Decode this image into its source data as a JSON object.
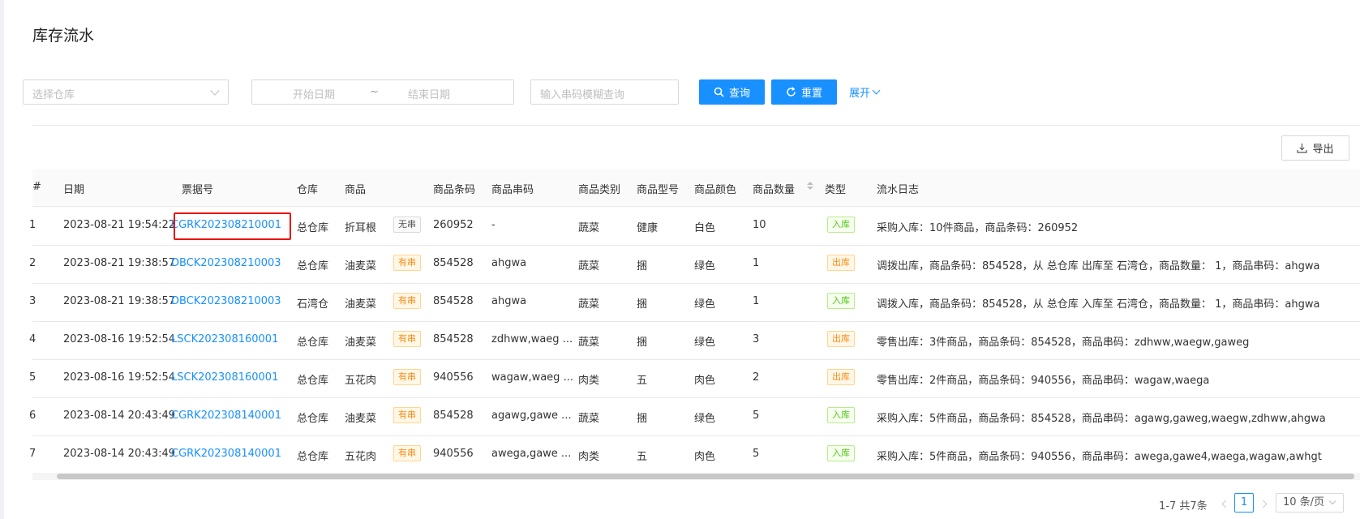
{
  "page": {
    "title": "库存流水"
  },
  "filters": {
    "warehouse_placeholder": "选择仓库",
    "start_date_placeholder": "开始日期",
    "date_separator": "~",
    "end_date_placeholder": "结束日期",
    "serial_placeholder": "输入串码模糊查询",
    "search_label": "查询",
    "reset_label": "重置",
    "expand_label": "展开"
  },
  "toolbar": {
    "export_label": "导出"
  },
  "table": {
    "columns": [
      "#",
      "日期",
      "票据号",
      "仓库",
      "商品",
      "商品条码",
      "商品串码",
      "商品类别",
      "商品型号",
      "商品颜色",
      "商品数量",
      "类型",
      "流水日志"
    ],
    "rows": [
      {
        "idx": "1",
        "date": "2023-08-21 19:54:22",
        "doc": "CGRK202308210001",
        "wh": "总仓库",
        "goods": "折耳根",
        "serial_tag": "无串",
        "barcode": "260952",
        "serial": "-",
        "cat": "蔬菜",
        "model": "健康",
        "color": "白色",
        "qty": "10",
        "type": "入库",
        "log": "采购入库：10件商品，商品条码：260952"
      },
      {
        "idx": "2",
        "date": "2023-08-21 19:38:57",
        "doc": "DBCK202308210003",
        "wh": "总仓库",
        "goods": "油麦菜",
        "serial_tag": "有串",
        "barcode": "854528",
        "serial": "ahgwa",
        "cat": "蔬菜",
        "model": "捆",
        "color": "绿色",
        "qty": "1",
        "type": "出库",
        "log": "调拨出库，商品条码：854528，从 总仓库 出库至 石湾仓，商品数量： 1，商品串码：ahgwa"
      },
      {
        "idx": "3",
        "date": "2023-08-21 19:38:57",
        "doc": "DBCK202308210003",
        "wh": "石湾仓",
        "goods": "油麦菜",
        "serial_tag": "有串",
        "barcode": "854528",
        "serial": "ahgwa",
        "cat": "蔬菜",
        "model": "捆",
        "color": "绿色",
        "qty": "1",
        "type": "入库",
        "log": "调拨入库，商品条码：854528，从 总仓库 入库至 石湾仓，商品数量： 1，商品串码：ahgwa"
      },
      {
        "idx": "4",
        "date": "2023-08-16 19:52:54",
        "doc": "LSCK202308160001",
        "wh": "总仓库",
        "goods": "油麦菜",
        "serial_tag": "有串",
        "barcode": "854528",
        "serial": "zdhww,waeg ...",
        "cat": "蔬菜",
        "model": "捆",
        "color": "绿色",
        "qty": "3",
        "type": "出库",
        "log": "零售出库：3件商品，商品条码：854528，商品串码：zdhww,waegw,gaweg"
      },
      {
        "idx": "5",
        "date": "2023-08-16 19:52:54",
        "doc": "LSCK202308160001",
        "wh": "总仓库",
        "goods": "五花肉",
        "serial_tag": "有串",
        "barcode": "940556",
        "serial": "wagaw,waeg ...",
        "cat": "肉类",
        "model": "五",
        "color": "肉色",
        "qty": "2",
        "type": "出库",
        "log": "零售出库：2件商品，商品条码：940556，商品串码：wagaw,waega"
      },
      {
        "idx": "6",
        "date": "2023-08-14 20:43:49",
        "doc": "CGRK202308140001",
        "wh": "总仓库",
        "goods": "油麦菜",
        "serial_tag": "有串",
        "barcode": "854528",
        "serial": "agawg,gawe ...",
        "cat": "蔬菜",
        "model": "捆",
        "color": "绿色",
        "qty": "5",
        "type": "入库",
        "log": "采购入库：5件商品，商品条码：854528，商品串码：agawg,gaweg,waegw,zdhww,ahgwa"
      },
      {
        "idx": "7",
        "date": "2023-08-14 20:43:49",
        "doc": "CGRK202308140001",
        "wh": "总仓库",
        "goods": "五花肉",
        "serial_tag": "有串",
        "barcode": "940556",
        "serial": "awega,gawe ...",
        "cat": "肉类",
        "model": "五",
        "color": "肉色",
        "qty": "5",
        "type": "入库",
        "log": "采购入库：5件商品，商品条码：940556，商品串码：awega,gawe4,waega,wagaw,awhgt"
      }
    ]
  },
  "pagination": {
    "total_label": "1-7 共7条",
    "current_page": "1",
    "page_size": "10 条/页"
  },
  "colors": {
    "primary": "#1890ff",
    "in_stock_tag": "#52c41a",
    "out_stock_tag": "#fa8c16",
    "highlight_box": "#e8140c"
  }
}
